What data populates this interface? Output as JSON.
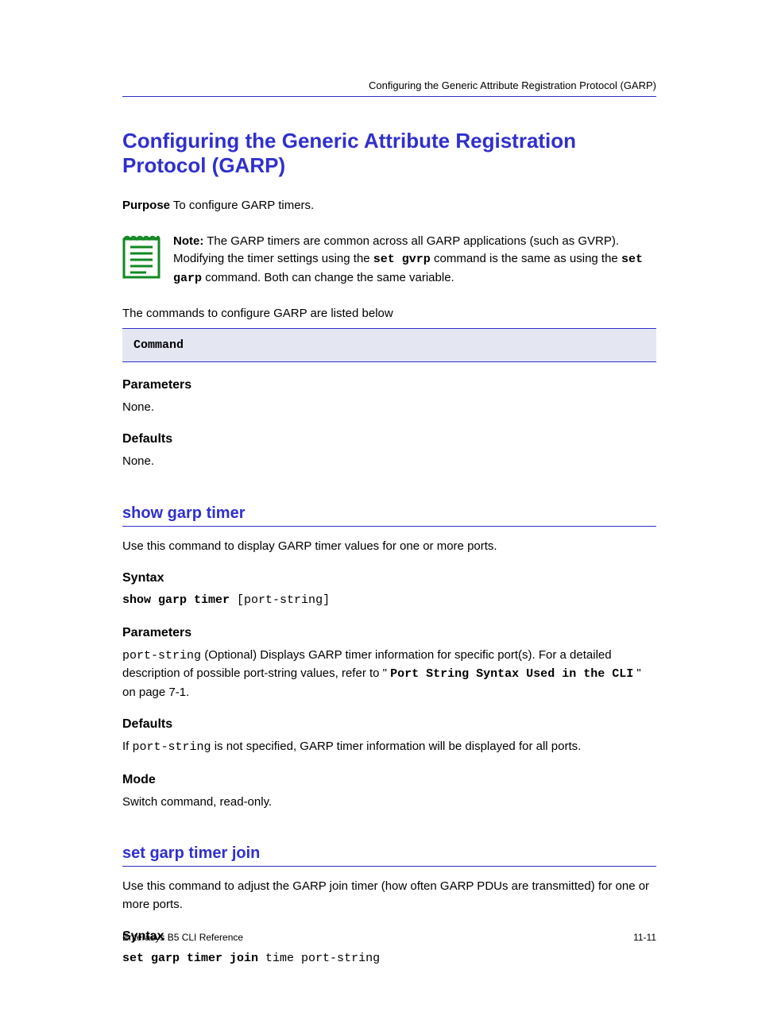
{
  "header": {
    "section": "Configuring the Generic Attribute Registration Protocol (GARP)"
  },
  "section1": {
    "heading": "Configuring the Generic Attribute Registration Protocol (GARP)",
    "purpose": {
      "label": "Purpose",
      "text": " To configure GARP timers."
    },
    "note": {
      "label": "Note:",
      "p1": " The GARP timers are common across all GARP applications (such as GVRP). Modifying the timer settings using the ",
      "cmd1": "set gvrp",
      "p2": " command is the same as using the ",
      "cmd2": "set garp",
      "p3": " command. Both can change the same variable."
    },
    "commands": {
      "intro": "The commands to configure GARP are listed below",
      "header": "Command",
      "parametersLabel": "Parameters",
      "parametersValue": "None.",
      "defaultsLabel": "Defaults",
      "defaultsValue": "None."
    }
  },
  "cmd1": {
    "title": "show garp timer",
    "desc": "Use this command to display GARP timer values for one or more ports.",
    "syntaxLabel": "Syntax",
    "syntax": {
      "fixed": "show garp timer",
      "variable": " [port-string]"
    },
    "paramsLabel": "Parameters",
    "params": {
      "name": "port-string",
      "desc": " (Optional) Displays GARP timer information for specific port(s). For a detailed description of possible port-string values, refer to \"",
      "refcmd": "Port String Syntax Used in the CLI",
      "tail": "\" on page 7-1."
    },
    "defaultsLabel": "Defaults",
    "defaults": {
      "p1": "If ",
      "ps": "port-string",
      "p2": " is not specified, GARP timer information will be displayed for all ports."
    },
    "modeLabel": "Mode",
    "modeValue": "Switch command, read-only."
  },
  "cmd2": {
    "title": "set garp timer join",
    "desc": "Use this command to adjust the GARP join timer (how often GARP PDUs are transmitted) for one or more ports.",
    "syntaxLabel": "Syntax",
    "syntax": {
      "fixed": "set garp timer join",
      "variable": " time port-string"
    }
  },
  "footer": {
    "docTitle": "Enterasys B5 CLI Reference",
    "pageNumber": "11-11"
  }
}
